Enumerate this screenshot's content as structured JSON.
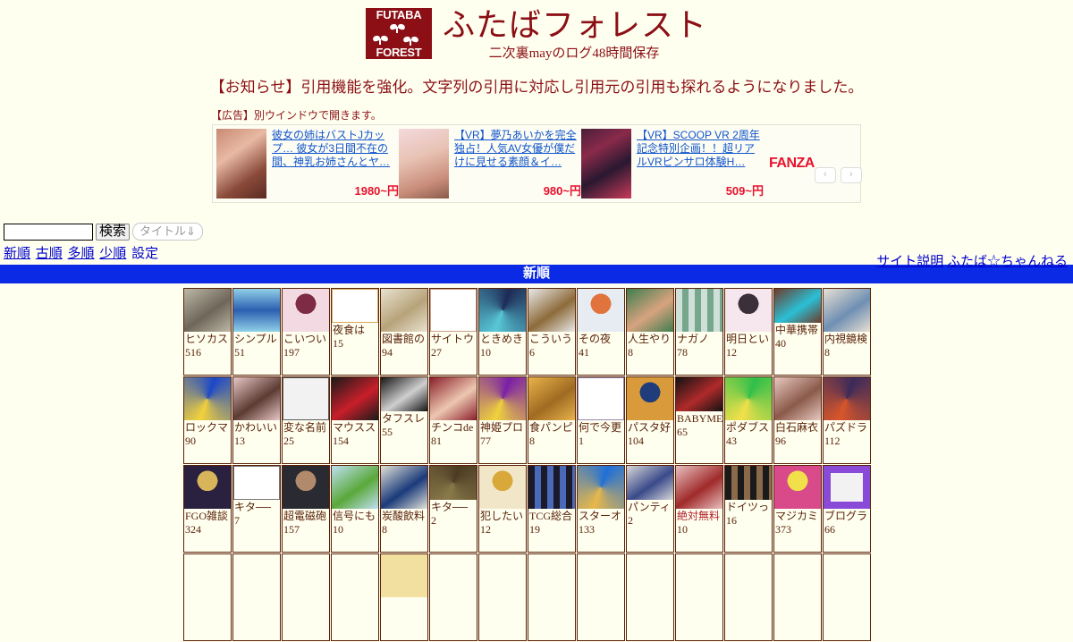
{
  "site": {
    "logo_top": "FUTABA",
    "logo_bottom": "FOREST",
    "title": "ふたばフォレスト",
    "subtitle": "二次裏mayのログ48時間保存",
    "notice": "【お知らせ】引用機能を強化。文字列の引用に対応し引用元の引用も探れるようになりました。"
  },
  "ad": {
    "label": "【広告】別ウインドウで開きます。",
    "brand": "FANZA",
    "prev_icon": "‹",
    "next_icon": "›",
    "items": [
      {
        "text": "彼女の姉はバストJカップ… 彼女が3日間不在の間、神乳お姉さんとヤ…",
        "price": "1980~円"
      },
      {
        "text": "【VR】夢乃あいかを完全独占！人気AV女優が僕だけに見せる素顔＆イ…",
        "price": "980~円"
      },
      {
        "text": "【VR】SCOOP VR 2周年記念特別企画！！超リアルVRピンサロ体験H…",
        "price": "509~円"
      }
    ]
  },
  "search": {
    "value": "",
    "placeholder": "",
    "button_label": "検索",
    "sort_select_label": "タイトル⇓"
  },
  "nav": {
    "left": [
      {
        "label": "新順",
        "underline": true
      },
      {
        "label": "古順",
        "underline": true
      },
      {
        "label": "多順",
        "underline": true
      },
      {
        "label": "少順",
        "underline": true
      },
      {
        "label": "設定",
        "underline": false
      }
    ],
    "right": [
      {
        "label": "サイト説明"
      },
      {
        "label": "ふたば☆ちゃんねる"
      }
    ]
  },
  "section": {
    "title": "新順"
  },
  "grid": {
    "rows": [
      [
        {
          "title": "ヒソカス",
          "count": "516",
          "c1": "#bdb8a6",
          "c2": "#6e665a",
          "style": "photo"
        },
        {
          "title": "シンプル",
          "count": "51",
          "c1": "#2b5fb0",
          "c2": "#8fd0e8",
          "style": "illust"
        },
        {
          "title": "こいつい",
          "count": "197",
          "c1": "#f2d9e2",
          "c2": "#7e2b45",
          "style": "anime"
        },
        {
          "title": "夜食は",
          "count": "15",
          "c1": "#ffffff",
          "c2": "#d9a85a",
          "style": "sketch",
          "tall": true
        },
        {
          "title": "図書館の",
          "count": "94",
          "c1": "#e8e2d0",
          "c2": "#b7a37a",
          "style": "photo"
        },
        {
          "title": "サイトウ",
          "count": "27",
          "c1": "#ffffff",
          "c2": "#caa184",
          "style": "sketch"
        },
        {
          "title": "ときめき",
          "count": "10",
          "c1": "#1d2a55",
          "c2": "#58c8d8",
          "style": "game"
        },
        {
          "title": "こういう",
          "count": "6",
          "c1": "#e9e9e9",
          "c2": "#8d6b3a",
          "style": "photo"
        },
        {
          "title": "その夜",
          "count": "41",
          "c1": "#e6ecf2",
          "c2": "#e0743c",
          "style": "anime"
        },
        {
          "title": "人生やり",
          "count": "8",
          "c1": "#3f7d4e",
          "c2": "#d7a37f",
          "style": "photo"
        },
        {
          "title": "ナガノ",
          "count": "78",
          "c1": "#cfe0d8",
          "c2": "#76a68b",
          "style": "grid"
        },
        {
          "title": "明日とい",
          "count": "12",
          "c1": "#f6e6ee",
          "c2": "#3b2f3a",
          "style": "anime"
        },
        {
          "title": "中華携帯",
          "count": "40",
          "c1": "#6d3b2a",
          "c2": "#2ac0d6",
          "style": "photo",
          "tall": true
        },
        {
          "title": "内視鏡検",
          "count": "8",
          "c1": "#e8e0d2",
          "c2": "#6f8fb3",
          "style": "photo"
        }
      ],
      [
        {
          "title": "ロックマ",
          "count": "90",
          "c1": "#1b47c8",
          "c2": "#f2d23a",
          "style": "game"
        },
        {
          "title": "かわいい",
          "count": "13",
          "c1": "#e7c7c7",
          "c2": "#5c3b33",
          "style": "photo"
        },
        {
          "title": "変な名前",
          "count": "25",
          "c1": "#f2f2f2",
          "c2": "#5c5c5c",
          "style": "sketch"
        },
        {
          "title": "マウスス",
          "count": "154",
          "c1": "#1a1a1a",
          "c2": "#c81f2a",
          "style": "photo"
        },
        {
          "title": "タフスレ",
          "count": "55",
          "c1": "#161616",
          "c2": "#cfcfcf",
          "style": "photo",
          "tall": true
        },
        {
          "title": "チンコde",
          "count": "81",
          "c1": "#8a1e2a",
          "c2": "#edc7b0",
          "style": "photo"
        },
        {
          "title": "神姫プロ",
          "count": "77",
          "c1": "#7a1fa8",
          "c2": "#f0d23c",
          "style": "game"
        },
        {
          "title": "食パンピ",
          "count": "8",
          "c1": "#e8b34a",
          "c2": "#a06a22",
          "style": "photo"
        },
        {
          "title": "何で今更",
          "count": "1",
          "c1": "#ffffff",
          "c2": "#9a8ab0",
          "style": "sketch"
        },
        {
          "title": "パスタ好",
          "count": "104",
          "c1": "#d89a3a",
          "c2": "#1f3d7a",
          "style": "anime"
        },
        {
          "title": "BABYMETA",
          "count": "65",
          "c1": "#121212",
          "c2": "#b02a2a",
          "style": "photo",
          "tall": true
        },
        {
          "title": "ポダブス",
          "count": "43",
          "c1": "#2fbf4a",
          "c2": "#f2e04a",
          "style": "game"
        },
        {
          "title": "白石麻衣",
          "count": "96",
          "c1": "#e8c8c0",
          "c2": "#8a5a4a",
          "style": "photo"
        },
        {
          "title": "パズドラ",
          "count": "112",
          "c1": "#3a2a5a",
          "c2": "#d8562a",
          "style": "game"
        }
      ],
      [
        {
          "title": "FGO雑談",
          "count": "324",
          "c1": "#2a2040",
          "c2": "#d8b45a",
          "style": "anime"
        },
        {
          "title": "キタ──",
          "count": "7",
          "c1": "#ffffff",
          "c2": "#777777",
          "style": "sketch",
          "tall": true
        },
        {
          "title": "超電磁砲",
          "count": "157",
          "c1": "#2a2a33",
          "c2": "#b08a6a",
          "style": "anime"
        },
        {
          "title": "信号にも",
          "count": "10",
          "c1": "#bfe0f2",
          "c2": "#5aa83a",
          "style": "photo"
        },
        {
          "title": "炭酸飲料",
          "count": "8",
          "c1": "#e2e2d8",
          "c2": "#1a3a7a",
          "style": "photo"
        },
        {
          "title": "キタ──",
          "count": "2",
          "c1": "#4a3a22",
          "c2": "#8a7a4a",
          "style": "game",
          "tall": true
        },
        {
          "title": "犯したい",
          "count": "12",
          "c1": "#f2e6c8",
          "c2": "#d8a83a",
          "style": "anime"
        },
        {
          "title": "TCG総合",
          "count": "19",
          "c1": "#1a1a2a",
          "c2": "#4a6ab8",
          "style": "grid"
        },
        {
          "title": "スターオ",
          "count": "133",
          "c1": "#1f6fd8",
          "c2": "#e8b84a",
          "style": "game"
        },
        {
          "title": "パンティ",
          "count": "2",
          "c1": "#d8d8d8",
          "c2": "#3a4a8a",
          "style": "photo",
          "tall": true
        },
        {
          "title": "絶対無料",
          "count": "10",
          "c1": "#e8c0c0",
          "c2": "#a02a2a",
          "style": "photo",
          "red": true
        },
        {
          "title": "ドイツっ",
          "count": "16",
          "c1": "#1a1a1a",
          "c2": "#8a6a4a",
          "style": "grid",
          "tall": true
        },
        {
          "title": "マジカミ",
          "count": "373",
          "c1": "#d84a8a",
          "c2": "#f2e04a",
          "style": "anime"
        },
        {
          "title": "ブログラ",
          "count": "66",
          "c1": "#f2f2f2",
          "c2": "#8a4ad8",
          "style": "logo"
        }
      ],
      [
        {
          "title": "",
          "count": "",
          "c1": "#fffff0",
          "c2": "#fffff0",
          "style": "blank"
        },
        {
          "title": "",
          "count": "",
          "c1": "#fffff0",
          "c2": "#fffff0",
          "style": "blank"
        },
        {
          "title": "",
          "count": "",
          "c1": "#fffff0",
          "c2": "#fffff0",
          "style": "blank"
        },
        {
          "title": "",
          "count": "",
          "c1": "#fffff0",
          "c2": "#fffff0",
          "style": "blank"
        },
        {
          "title": "",
          "count": "",
          "c1": "#f2e0a0",
          "c2": "#e8c060",
          "style": "blank"
        },
        {
          "title": "",
          "count": "",
          "c1": "#fffff0",
          "c2": "#fffff0",
          "style": "blank"
        },
        {
          "title": "",
          "count": "",
          "c1": "#fffff0",
          "c2": "#fffff0",
          "style": "blank"
        },
        {
          "title": "",
          "count": "",
          "c1": "#fffff0",
          "c2": "#fffff0",
          "style": "blank"
        },
        {
          "title": "",
          "count": "",
          "c1": "#fffff0",
          "c2": "#fffff0",
          "style": "blank"
        },
        {
          "title": "",
          "count": "",
          "c1": "#fffff0",
          "c2": "#fffff0",
          "style": "blank"
        },
        {
          "title": "",
          "count": "",
          "c1": "#fffff0",
          "c2": "#fffff0",
          "style": "blank"
        },
        {
          "title": "",
          "count": "",
          "c1": "#fffff0",
          "c2": "#fffff0",
          "style": "blank"
        },
        {
          "title": "",
          "count": "",
          "c1": "#fffff0",
          "c2": "#fffff0",
          "style": "blank"
        },
        {
          "title": "",
          "count": "",
          "c1": "#fffff0",
          "c2": "#fffff0",
          "style": "blank"
        }
      ]
    ]
  },
  "colors": {
    "brand": "#8b0f14",
    "accent_blue": "#0a2ae6",
    "link": "#0000cc",
    "cell_border": "#5a2208",
    "page_bg": "#fffff0",
    "price": "#e8112d"
  }
}
